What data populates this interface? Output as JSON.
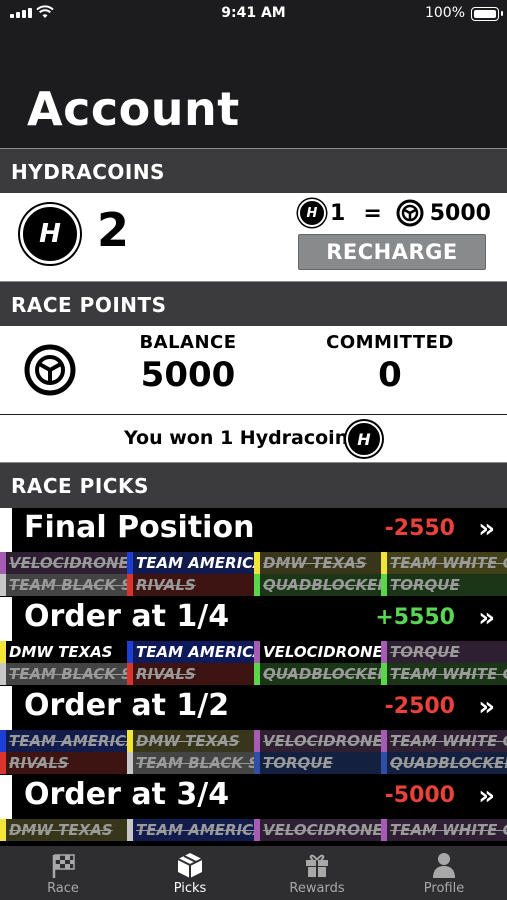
{
  "status": {
    "time": "9:41 AM",
    "battery": "100%"
  },
  "page_title": "Account",
  "hydracoins": {
    "header": "HYDRACOINS",
    "count": "2",
    "rate_left": "1",
    "rate_eq": "=",
    "rate_right": "5000",
    "recharge_label": "RECHARGE"
  },
  "race_points": {
    "header": "RACE POINTS",
    "balance_label": "BALANCE",
    "balance_value": "5000",
    "committed_label": "COMMITTED",
    "committed_value": "0"
  },
  "won_message": "You won 1 Hydracoin!",
  "race_picks": {
    "header": "RACE PICKS",
    "picks": [
      {
        "title": "Final Position",
        "score": "-2550",
        "score_color": "#e8423b",
        "teams": [
          {
            "name": "VELOCIDRONE",
            "color": "#a65bb5",
            "bg": "#2e1f32",
            "lost": true
          },
          {
            "name": "TEAM AMERICA",
            "color": "#1e3fd6",
            "bg": "#121c4c",
            "lost": false,
            "right": true
          },
          {
            "name": "DMW TEXAS",
            "color": "#f2e537",
            "bg": "#37351a",
            "lost": true
          },
          {
            "name": "TEAM WHITE GOAT",
            "color": "#f2e537",
            "bg": "#414018",
            "lost": true,
            "right": true
          },
          {
            "name": "TEAM BLACK SHEEP",
            "color": "#c8c8c8",
            "bg": "#444444",
            "lost": true,
            "right": true
          },
          {
            "name": "RIVALS",
            "color": "#d9352c",
            "bg": "#3d1412",
            "lost": true
          },
          {
            "name": "QUADBLOCKERS",
            "color": "#59d64a",
            "bg": "#1b3617",
            "lost": true
          },
          {
            "name": "TORQUE",
            "color": "#59d64a",
            "bg": "#1b3617",
            "lost": true
          }
        ]
      },
      {
        "title": "Order at 1/4",
        "score": "+5550",
        "score_color": "#5ad655",
        "teams": [
          {
            "name": "DMW TEXAS",
            "color": "#f2e537",
            "bg": "#000000",
            "lost": false
          },
          {
            "name": "TEAM AMERICA",
            "color": "#1e3fd6",
            "bg": "#0f1a5a",
            "lost": false,
            "right": true
          },
          {
            "name": "VELOCIDRONE",
            "color": "#a65bb5",
            "bg": "#000000",
            "lost": false
          },
          {
            "name": "TORQUE",
            "color": "#a65bb5",
            "bg": "#2e1f32",
            "lost": true
          },
          {
            "name": "TEAM BLACK SHEEP",
            "color": "#c8c8c8",
            "bg": "#444444",
            "lost": true,
            "right": true
          },
          {
            "name": "RIVALS",
            "color": "#d9352c",
            "bg": "#3d1412",
            "lost": true
          },
          {
            "name": "QUADBLOCKERS",
            "color": "#59d64a",
            "bg": "#1b3617",
            "lost": true
          },
          {
            "name": "TEAM WHITE GOAT",
            "color": "#59d64a",
            "bg": "#1b3617",
            "lost": true,
            "right": true
          }
        ]
      },
      {
        "title": "Order at 1/2",
        "score": "-2500",
        "score_color": "#e8423b",
        "teams": [
          {
            "name": "TEAM AMERICA",
            "color": "#1e3fd6",
            "bg": "#121c4c",
            "lost": true,
            "right": true
          },
          {
            "name": "DMW TEXAS",
            "color": "#f2e537",
            "bg": "#37351a",
            "lost": true
          },
          {
            "name": "VELOCIDRONE",
            "color": "#a65bb5",
            "bg": "#2e1f32",
            "lost": true
          },
          {
            "name": "TEAM WHITE GOAT",
            "color": "#a65bb5",
            "bg": "#2e1f32",
            "lost": true,
            "right": true
          },
          {
            "name": "RIVALS",
            "color": "#d9352c",
            "bg": "#3d1412",
            "lost": true
          },
          {
            "name": "TEAM BLACK SHEEP",
            "color": "#c8c8c8",
            "bg": "#444444",
            "lost": true,
            "right": true
          },
          {
            "name": "TORQUE",
            "color": "#2d4fa8",
            "bg": "#13203f",
            "lost": true
          },
          {
            "name": "QUADBLOCKERS",
            "color": "#2d4fa8",
            "bg": "#13203f",
            "lost": true
          }
        ]
      },
      {
        "title": "Order at 3/4",
        "score": "-5000",
        "score_color": "#e8423b",
        "teams": [
          {
            "name": "DMW TEXAS",
            "color": "#f2e537",
            "bg": "#37351a",
            "lost": true
          },
          {
            "name": "TEAM AMERICA",
            "color": "#c8c8c8",
            "bg": "#121c4c",
            "lost": true,
            "right": true
          },
          {
            "name": "VELOCIDRONE",
            "color": "#a65bb5",
            "bg": "#2e1f32",
            "lost": true
          },
          {
            "name": "TEAM WHITE GOAT",
            "color": "#a65bb5",
            "bg": "#2e1f32",
            "lost": true,
            "right": true
          }
        ]
      }
    ]
  },
  "tabs": [
    {
      "label": "Race",
      "icon": "checkered-flag-icon"
    },
    {
      "label": "Picks",
      "icon": "box-icon",
      "active": true
    },
    {
      "label": "Rewards",
      "icon": "gift-icon"
    },
    {
      "label": "Profile",
      "icon": "person-icon"
    }
  ]
}
